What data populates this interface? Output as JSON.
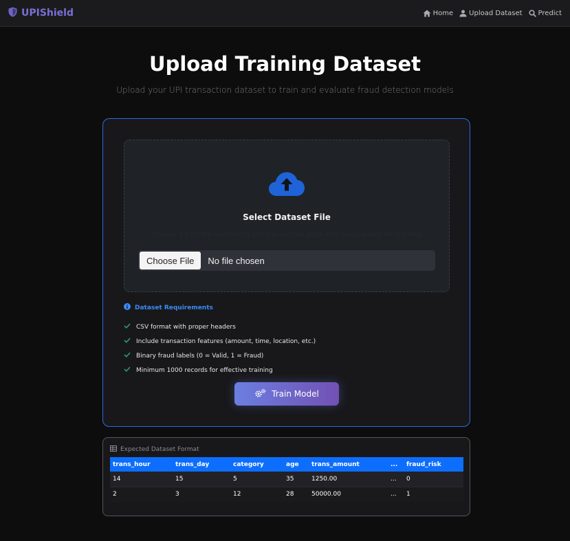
{
  "nav": {
    "brand": "UPIShield",
    "links": [
      {
        "label": "Home",
        "icon": "home-icon"
      },
      {
        "label": "Upload Dataset",
        "icon": "upload-user-icon"
      },
      {
        "label": "Predict",
        "icon": "search-icon"
      }
    ]
  },
  "hero": {
    "title": "Upload Training Dataset",
    "subtitle": "Upload your UPI transaction dataset to train and evaluate fraud detection models"
  },
  "dropzone": {
    "icon": "cloud-upload-icon",
    "title": "Select Dataset File",
    "hint": "Choose a CSV file containing UPI transaction data with fraud labels for training",
    "choose_label": "Choose File",
    "file_status": "No file chosen"
  },
  "requirements": {
    "title": "Dataset Requirements",
    "items": [
      "CSV format with proper headers",
      "Include transaction features (amount, time, location, etc.)",
      "Binary fraud labels (0 = Valid, 1 = Fraud)",
      "Minimum 1000 records for effective training"
    ]
  },
  "train_button": {
    "label": "Train Model",
    "icon": "gears-icon"
  },
  "format_table": {
    "title": "Expected Dataset Format",
    "columns": [
      "trans_hour",
      "trans_day",
      "category",
      "age",
      "trans_amount",
      "...",
      "fraud_risk"
    ],
    "rows": [
      [
        "14",
        "15",
        "5",
        "35",
        "1250.00",
        "...",
        "0"
      ],
      [
        "2",
        "3",
        "12",
        "28",
        "50000.00",
        "...",
        "1"
      ]
    ]
  },
  "colors": {
    "accent": "#2f6ae0",
    "brand": "#7a6fd6",
    "table_header": "#0d6efd",
    "check": "#2e9a62"
  }
}
